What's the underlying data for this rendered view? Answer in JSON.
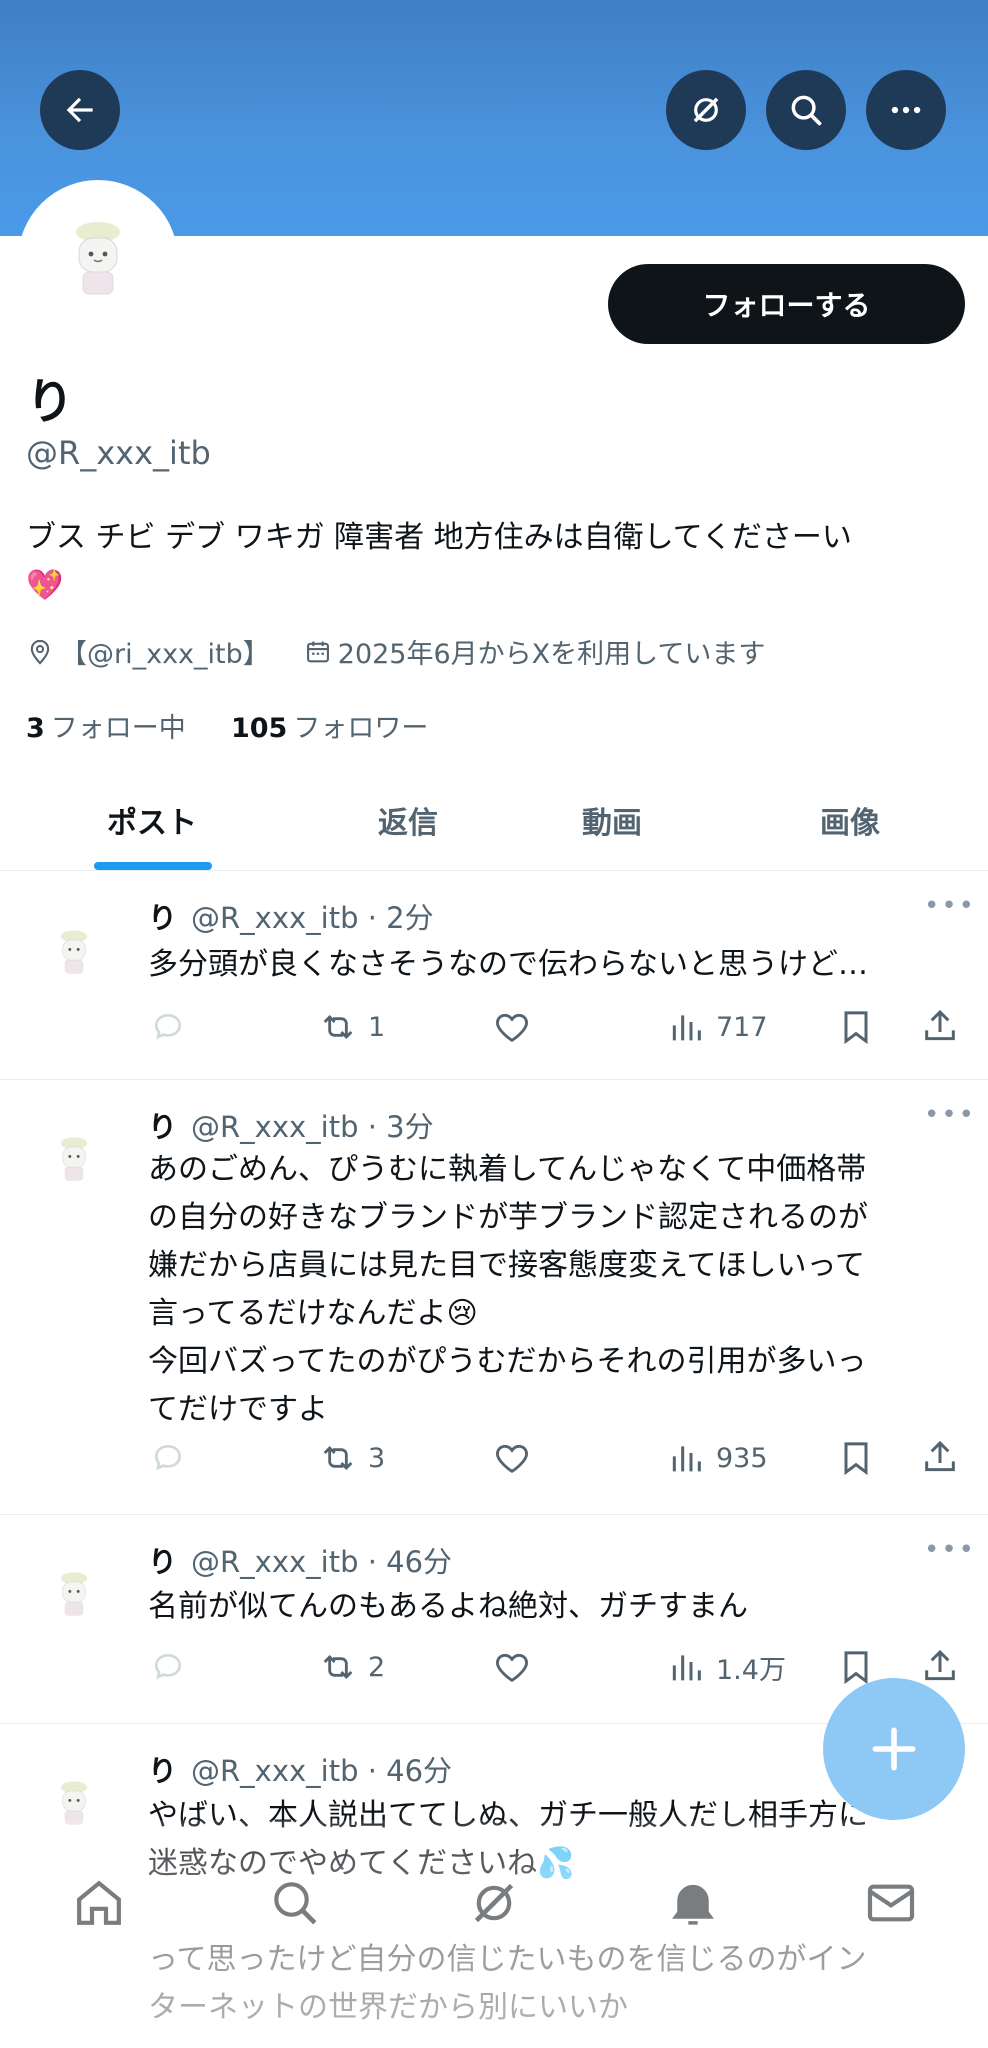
{
  "header": {
    "back_icon": "arrow-left-icon",
    "grok_icon": "grok-icon",
    "search_icon": "search-icon",
    "more_icon": "more-icon"
  },
  "profile": {
    "name": "り",
    "handle": "@R_xxx_itb",
    "follow_label": "フォローする",
    "bio_line1": "ブス チビ デブ ワキガ 障害者 地方住みは自衛してくださーい",
    "bio_emoji": "💖",
    "location": "【@ri_xxx_itb】",
    "joined": "2025年6月からXを利用しています",
    "following_count": "3",
    "following_label": "フォロー中",
    "followers_count": "105",
    "followers_label": "フォロワー"
  },
  "tabs": [
    {
      "label": "ポスト",
      "active": true
    },
    {
      "label": "返信",
      "active": false
    },
    {
      "label": "動画",
      "active": false
    },
    {
      "label": "画像",
      "active": false
    }
  ],
  "posts": [
    {
      "name": "り",
      "handle": "@R_xxx_itb",
      "time": "2分",
      "lines": [
        "多分頭が良くなさそうなので伝わらないと思うけど…"
      ],
      "retweets": "1",
      "likes": "",
      "views": "717"
    },
    {
      "name": "り",
      "handle": "@R_xxx_itb",
      "time": "3分",
      "lines": [
        "あのごめん、ぴうむに執着してんじゃなくて中価格帯",
        "の自分の好きなブランドが芋ブランド認定されるのが",
        "嫌だから店員には見た目で接客態度変えてほしいって",
        "言ってるだけなんだよ😢",
        "今回バズってたのがぴうむだからそれの引用が多いっ",
        "てだけですよ"
      ],
      "retweets": "3",
      "likes": "",
      "views": "935"
    },
    {
      "name": "り",
      "handle": "@R_xxx_itb",
      "time": "46分",
      "lines": [
        "名前が似てんのもあるよね絶対、ガチすまん"
      ],
      "retweets": "2",
      "likes": "",
      "views": "1.4万"
    },
    {
      "name": "り",
      "handle": "@R_xxx_itb",
      "time": "46分",
      "lines": [
        "やばい、本人説出ててしぬ、ガチ一般人だし相手方に",
        "迷惑なのでやめてくださいね💦",
        "",
        "って思ったけど自分の信じたいものを信じるのがイン",
        "ターネットの世界だから別にいいか"
      ],
      "retweets": "",
      "likes": "",
      "views": ""
    }
  ],
  "fab_icon": "plus-icon",
  "bottom_nav": [
    "home-icon",
    "search-icon",
    "grok-icon",
    "notifications-icon",
    "messages-icon"
  ],
  "colors": {
    "banner": "#4a92dc",
    "accent": "#1d9bf0",
    "text": "#0f1419",
    "secondary": "#536471"
  }
}
